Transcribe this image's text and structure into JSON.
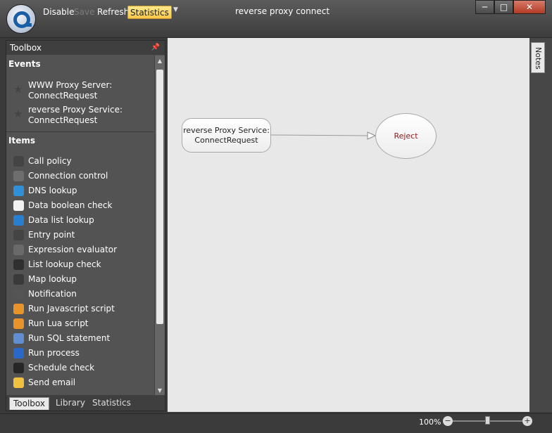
{
  "titlebar": {
    "title": "reverse proxy connect",
    "buttons": {
      "disable": "Disable",
      "save": "Save",
      "refresh": "Refresh",
      "statistics": "Statistics"
    },
    "window_controls": {
      "minimize": "─",
      "maximize": "□",
      "close": "✕"
    }
  },
  "toolbox": {
    "title": "Toolbox",
    "events_heading": "Events",
    "events": [
      {
        "line1": "WWW Proxy Server:",
        "line2": "ConnectRequest",
        "icon": "star-icon"
      },
      {
        "line1": "reverse Proxy Service:",
        "line2": "ConnectRequest",
        "icon": "star-icon"
      }
    ],
    "items_heading": "Items",
    "items": [
      {
        "label": "Call policy",
        "icon": "call-policy-icon",
        "color": "#444444"
      },
      {
        "label": "Connection control",
        "icon": "connection-control-icon",
        "color": "#6e6e6e"
      },
      {
        "label": "DNS lookup",
        "icon": "dns-globe-icon",
        "color": "#2f8fd8"
      },
      {
        "label": "Data boolean check",
        "icon": "boolean-check-icon",
        "color": "#f2f2f2"
      },
      {
        "label": "Data list lookup",
        "icon": "list-globe-icon",
        "color": "#2a7ed0"
      },
      {
        "label": "Entry point",
        "icon": "entry-point-icon",
        "color": "#444444"
      },
      {
        "label": "Expression evaluator",
        "icon": "expression-pen-icon",
        "color": "#6a6a6a"
      },
      {
        "label": "List lookup check",
        "icon": "list-check-icon",
        "color": "#2f2f2f"
      },
      {
        "label": "Map lookup",
        "icon": "map-lookup-icon",
        "color": "#3a3a3a"
      },
      {
        "label": "Notification",
        "icon": "notification-icon",
        "color": "#555555"
      },
      {
        "label": "Run Javascript script",
        "icon": "gear-orange-icon",
        "color": "#e8942a"
      },
      {
        "label": "Run Lua script",
        "icon": "gear-orange-icon",
        "color": "#e8942a"
      },
      {
        "label": "Run SQL statement",
        "icon": "sql-database-icon",
        "color": "#5f8fd0"
      },
      {
        "label": "Run process",
        "icon": "run-process-icon",
        "color": "#2a68c8"
      },
      {
        "label": "Schedule check",
        "icon": "calendar-icon",
        "color": "#262626"
      },
      {
        "label": "Send email",
        "icon": "envelope-icon",
        "color": "#f0c040"
      }
    ],
    "tabs": [
      "Toolbox",
      "Library",
      "Statistics"
    ]
  },
  "canvas": {
    "event_node": {
      "line1": "reverse Proxy Service:",
      "line2": "ConnectRequest"
    },
    "reject_node": "Reject",
    "notes_tab": "Notes"
  },
  "statusbar": {
    "zoom": "100%",
    "zoom_out": "−",
    "zoom_in": "+"
  }
}
